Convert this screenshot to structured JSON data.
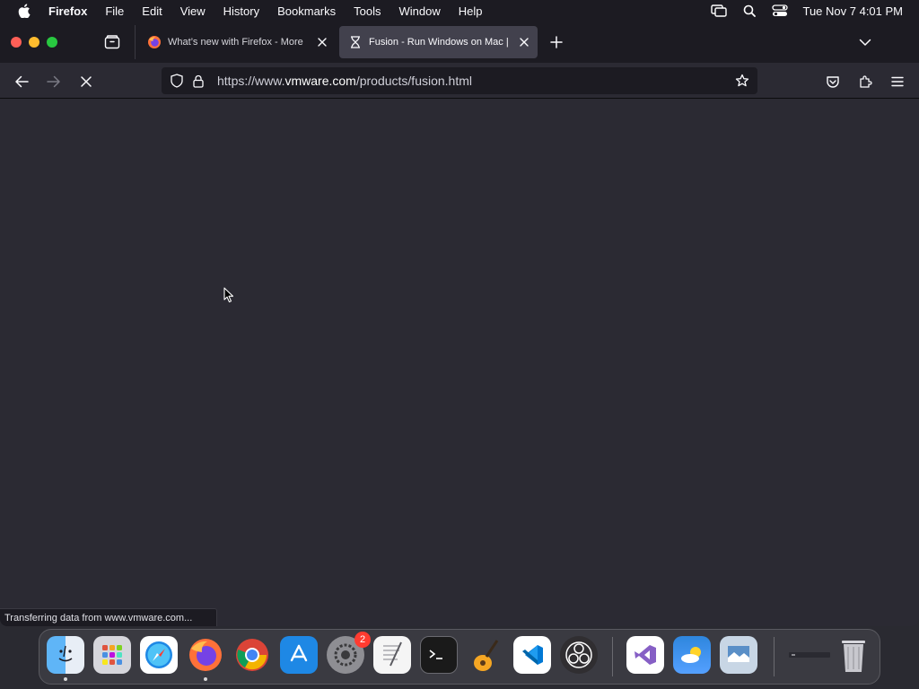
{
  "menubar": {
    "app_name": "Firefox",
    "menus": [
      "File",
      "Edit",
      "View",
      "History",
      "Bookmarks",
      "Tools",
      "Window",
      "Help"
    ],
    "clock": "Tue Nov 7  4:01 PM",
    "status_icons": [
      "screen-mirroring-icon",
      "spotlight-search-icon",
      "control-center-icon"
    ]
  },
  "tabs": [
    {
      "title": "What’s new with Firefox - More",
      "favicon": "firefox-icon",
      "active": false
    },
    {
      "title": "Fusion - Run Windows on Mac |",
      "favicon": "loading-hourglass-icon",
      "active": true
    }
  ],
  "navbar": {
    "url_prefix": "https://www.",
    "url_host": "vmware.com",
    "url_path": "/products/fusion.html",
    "state": "loading"
  },
  "status_panel": "Transferring data from www.vmware.com...",
  "dock": {
    "apps": [
      {
        "name": "Finder",
        "icon": "finder-icon",
        "running": true
      },
      {
        "name": "Launchpad",
        "icon": "launchpad-icon",
        "running": false
      },
      {
        "name": "Safari",
        "icon": "safari-icon",
        "running": false
      },
      {
        "name": "Firefox",
        "icon": "firefox-icon",
        "running": true
      },
      {
        "name": "Chrome",
        "icon": "chrome-icon",
        "running": false
      },
      {
        "name": "App Store",
        "icon": "app-store-icon",
        "running": false
      },
      {
        "name": "System Settings",
        "icon": "system-settings-icon",
        "running": false,
        "badge": "2"
      },
      {
        "name": "TextEdit",
        "icon": "textedit-icon",
        "running": false
      },
      {
        "name": "Terminal",
        "icon": "terminal-icon",
        "running": false
      },
      {
        "name": "GarageBand",
        "icon": "garageband-icon",
        "running": false
      },
      {
        "name": "Visual Studio Code",
        "icon": "vscode-icon",
        "running": false
      },
      {
        "name": "OBS",
        "icon": "obs-icon",
        "running": false
      },
      {
        "name": "Visual Studio",
        "icon": "visual-studio-icon",
        "running": false
      },
      {
        "name": "Weather",
        "icon": "weather-icon",
        "running": false
      },
      {
        "name": "Preview",
        "icon": "preview-icon",
        "running": false
      },
      {
        "name": "Minimized Window",
        "icon": "minimized-window-icon",
        "running": false
      },
      {
        "name": "Trash",
        "icon": "trash-icon",
        "running": false
      }
    ]
  },
  "colors": {
    "chrome_dark": "#1c1b22",
    "active_tab": "#42414d",
    "content_bg": "#2b2a33"
  }
}
